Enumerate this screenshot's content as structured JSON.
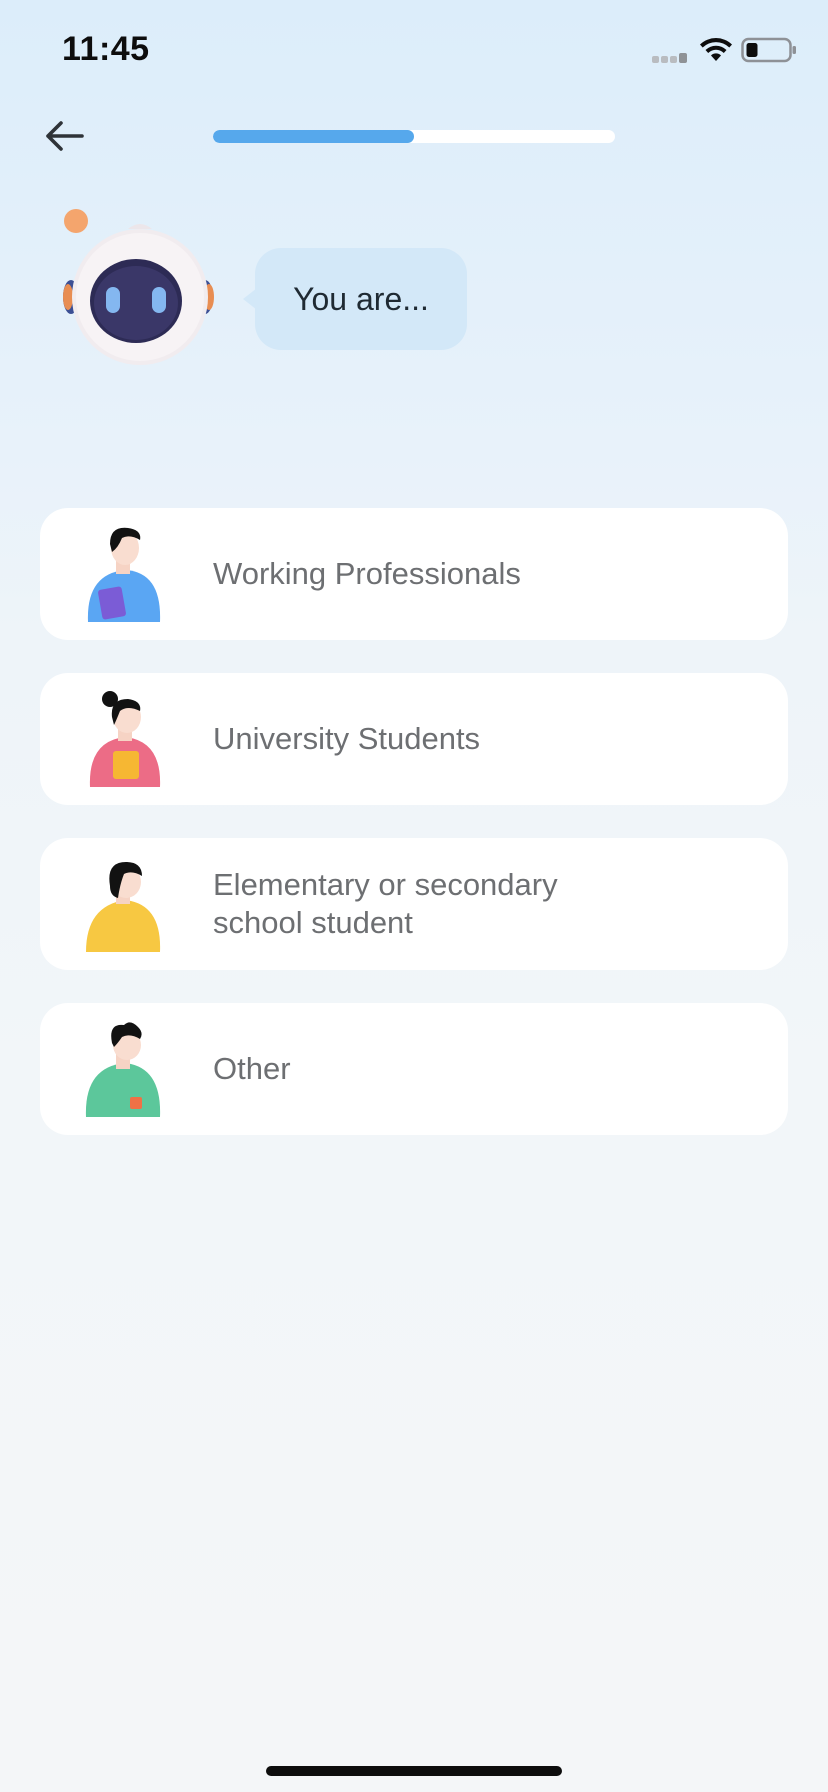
{
  "status_bar": {
    "time": "11:45",
    "icons": [
      "signal-icon",
      "wifi-icon",
      "battery-icon"
    ]
  },
  "header": {
    "back_icon": "arrow-left-icon",
    "progress": 0.5
  },
  "prompt": {
    "text": "You are..."
  },
  "options": [
    {
      "label": "Working Professionals",
      "avatar": "man-blue-shirt-icon",
      "color": "#5aa6f3"
    },
    {
      "label": "University Students",
      "avatar": "woman-pink-shirt-icon",
      "color": "#ec6c86"
    },
    {
      "label": "Elementary or secondary school student",
      "avatar": "child-yellow-shirt-icon",
      "color": "#f7c842"
    },
    {
      "label": "Other",
      "avatar": "person-green-shirt-icon",
      "color": "#5cc79b"
    }
  ],
  "colors": {
    "accent": "#56a8ec",
    "bubble": "#d3e8f8",
    "card": "#ffffff"
  }
}
